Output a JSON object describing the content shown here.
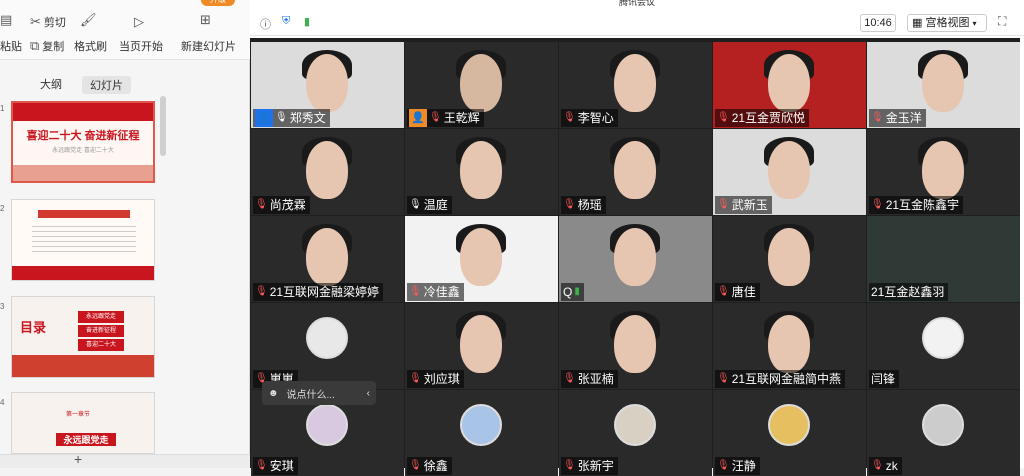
{
  "ribbon": {
    "paste": "粘贴",
    "cut": "剪切",
    "copy": "复制",
    "format_painter": "格式刷",
    "play_current": "当页开始",
    "new_slide": "新建幻灯片",
    "badge": "升级"
  },
  "panel": {
    "tabs": [
      "大纲",
      "幻灯片"
    ],
    "slides": [
      {
        "num": "1",
        "title": "喜迎二十大 奋进新征程",
        "subtitle": "永远跟党走 喜迎二十大"
      },
      {
        "num": "2",
        "title": "",
        "subtitle": ""
      },
      {
        "num": "3",
        "title": "目录",
        "items": [
          "永远跟党走",
          "奋进新征程",
          "喜迎二十大"
        ]
      },
      {
        "num": "4",
        "title": "永远跟党走",
        "subtitle": "第一章节"
      }
    ],
    "bottom_add": "+"
  },
  "meeting": {
    "window_title": "腾讯会议",
    "time": "10:46",
    "view_label": "宫格视图",
    "participants": [
      {
        "name": "郑秀文",
        "role": "host"
      },
      {
        "name": "王乾辉",
        "role": "cohost"
      },
      {
        "name": "李智心"
      },
      {
        "name": "21互金贾欣悦"
      },
      {
        "name": "金玉洋"
      },
      {
        "name": "尚茂霖"
      },
      {
        "name": "温庭"
      },
      {
        "name": "杨瑶"
      },
      {
        "name": "武新玉"
      },
      {
        "name": "21互金陈鑫宇"
      },
      {
        "name": "21互联网金融梁婷婷"
      },
      {
        "name": "冷佳鑫"
      },
      {
        "name": "Q"
      },
      {
        "name": "唐佳"
      },
      {
        "name": "21互金赵鑫羽"
      },
      {
        "name": "崽崽"
      },
      {
        "name": "刘应琪"
      },
      {
        "name": "张亚楠"
      },
      {
        "name": "21互联网金融简中燕"
      },
      {
        "name": "闫锋"
      },
      {
        "name": "安琪"
      },
      {
        "name": "徐鑫"
      },
      {
        "name": "张新宇"
      },
      {
        "name": "汪静"
      },
      {
        "name": "zk"
      }
    ],
    "chat_placeholder": "说点什么..."
  },
  "colors": {
    "accent": "#1e73e8",
    "orange": "#f08a24",
    "brand_red": "#c9151e"
  }
}
